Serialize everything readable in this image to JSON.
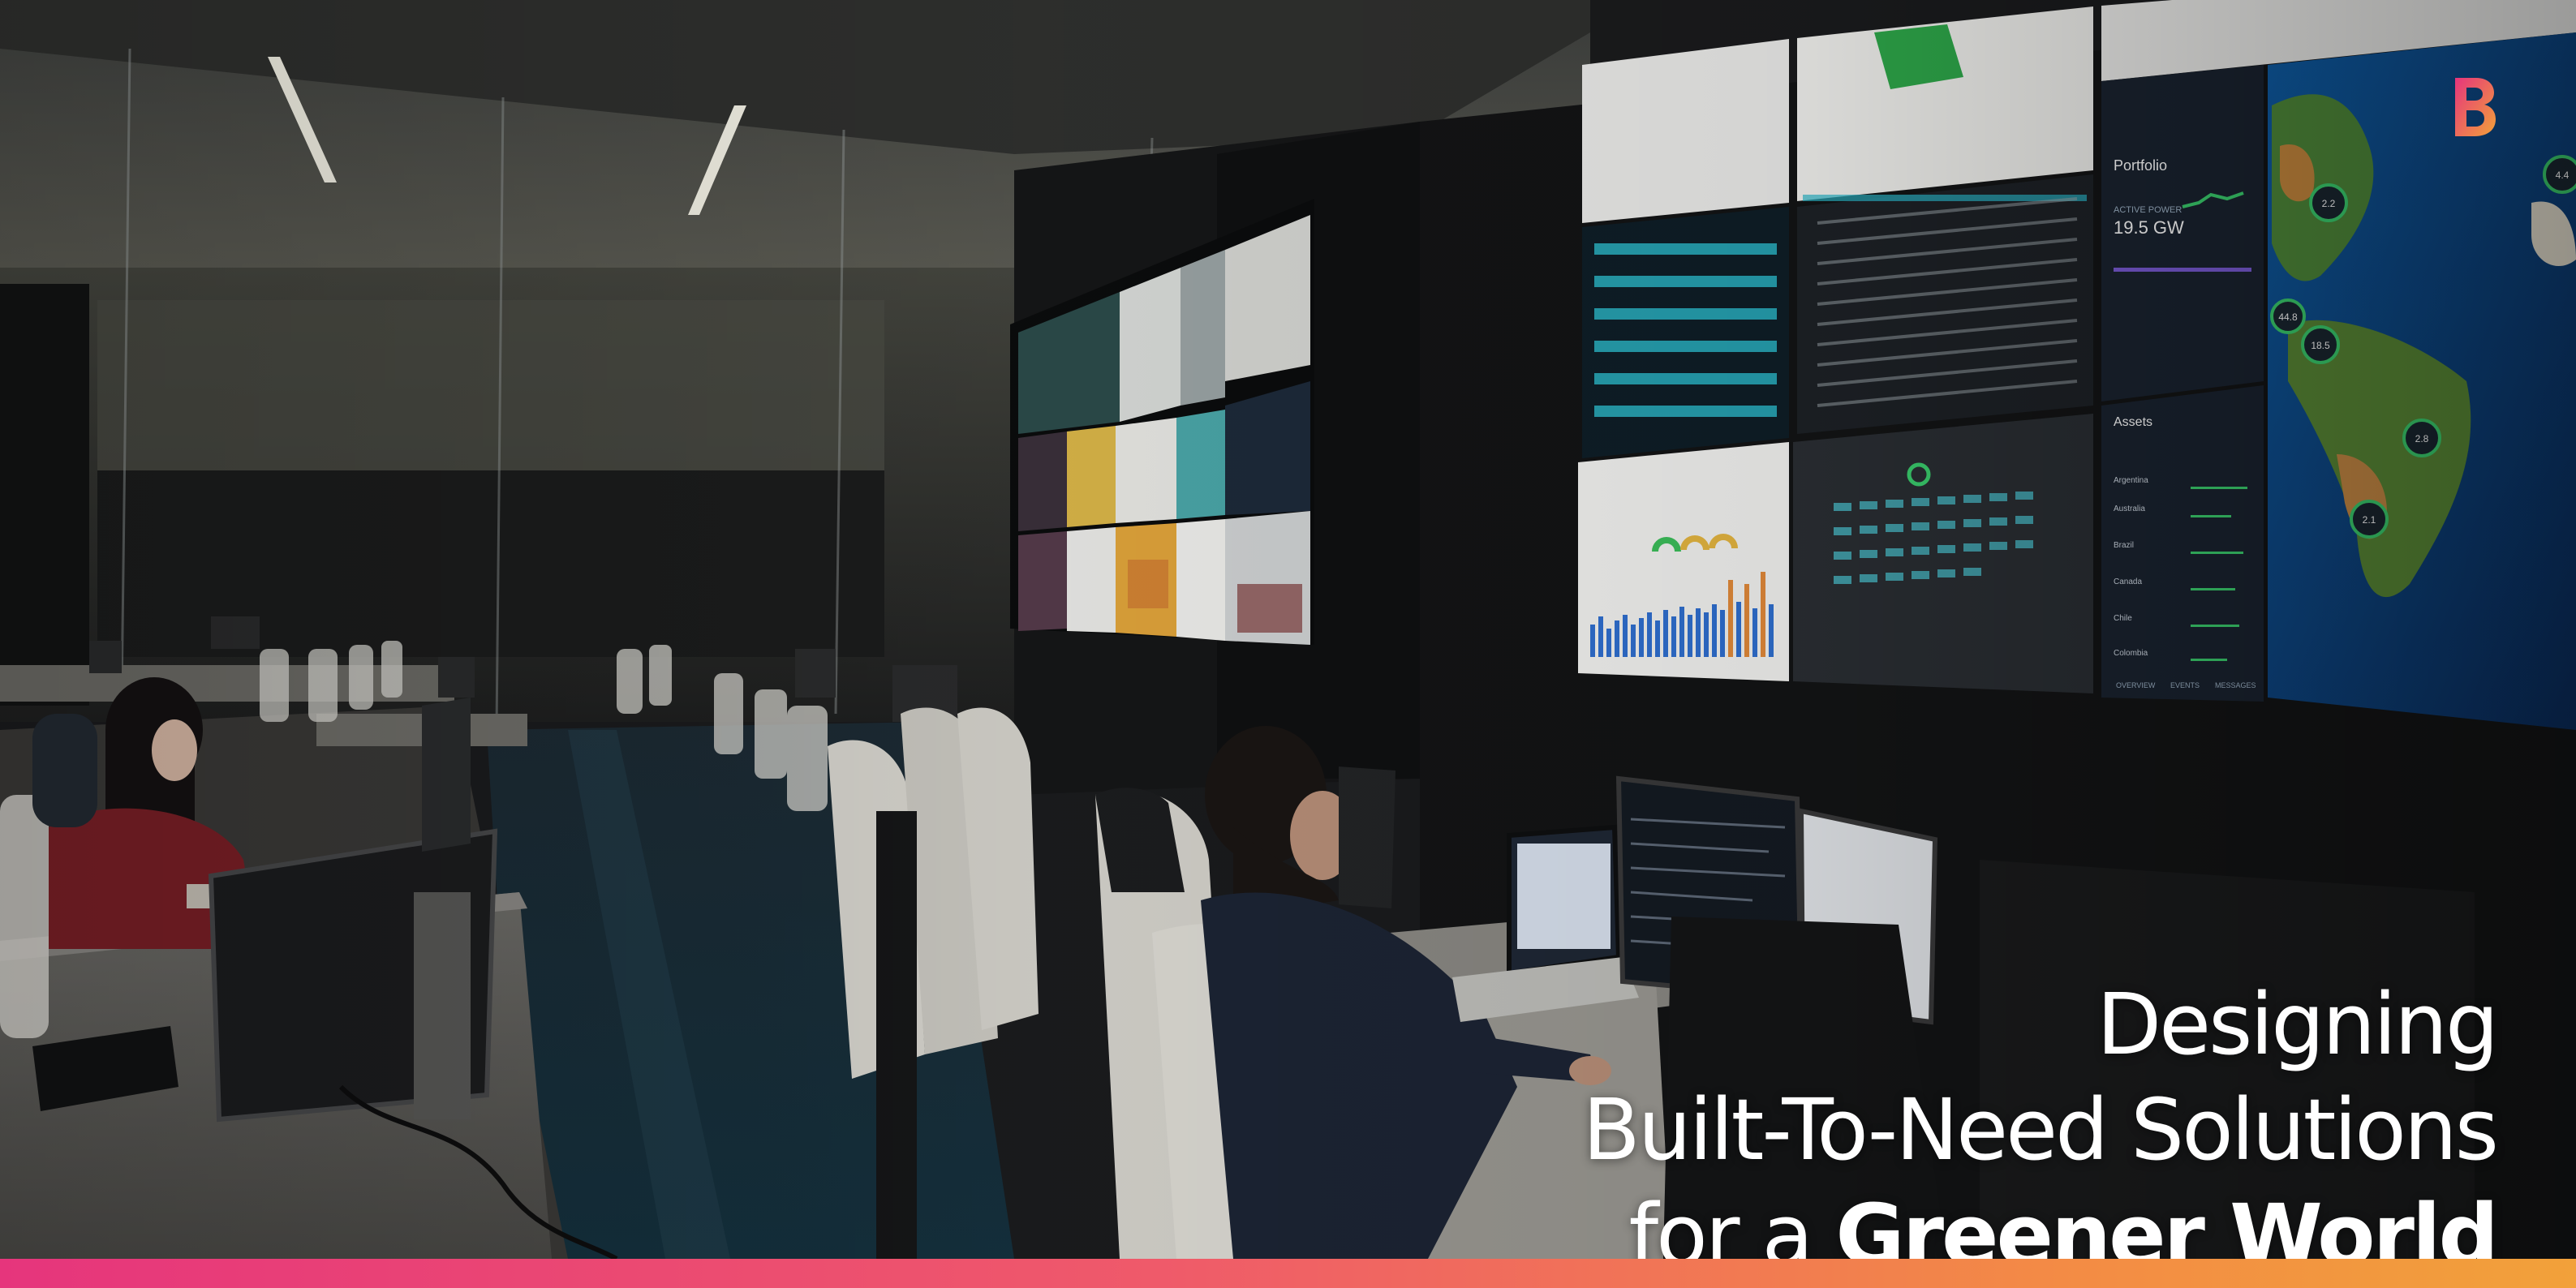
{
  "brand": {
    "logo_letter": "B",
    "logo_colors": [
      "#e6357c",
      "#f2a13a"
    ]
  },
  "headline": {
    "line1": "Designing",
    "line2": "Built-To-Need Solutions",
    "line3_regular": "for a ",
    "line3_bold": "Greener World"
  },
  "accent_bar": {
    "colors": [
      "#e6357c",
      "#ef5a6a",
      "#f38b45",
      "#f2a13a"
    ]
  },
  "dashboard": {
    "portfolio_title": "Portfolio",
    "active_power": "ACTIVE POWER",
    "active_power_value": "19.5 GW",
    "assets_title": "Assets",
    "tabs": [
      "OVERVIEW",
      "EVENTS",
      "MESSAGES"
    ],
    "asset_rows": [
      "Argentina",
      "Australia",
      "Brazil",
      "Canada",
      "Chile",
      "Colombia"
    ],
    "map_markers": [
      "2.2",
      "4.4",
      "2.8",
      "2.1",
      "18.5",
      "44.8"
    ]
  }
}
